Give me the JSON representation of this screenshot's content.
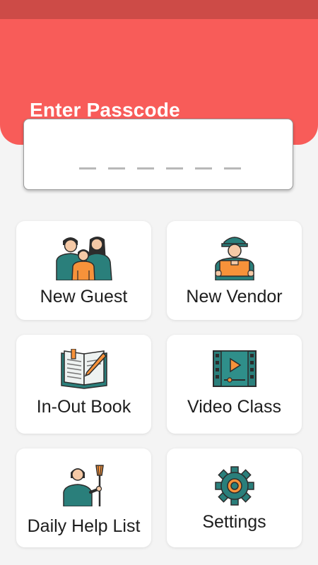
{
  "header": {
    "title": "Enter Passcode"
  },
  "passcode": {
    "length": 6,
    "entered": ""
  },
  "menu": [
    {
      "label": "New Guest",
      "icon": "family-icon"
    },
    {
      "label": "New Vendor",
      "icon": "delivery-person-icon"
    },
    {
      "label": "In-Out Book",
      "icon": "book-icon"
    },
    {
      "label": "Video Class",
      "icon": "video-icon"
    },
    {
      "label": "Daily Help List",
      "icon": "house-help-icon"
    },
    {
      "label": "Settings",
      "icon": "gear-icon"
    }
  ],
  "colors": {
    "header": "#f85c59",
    "status_bar": "#cd4b47",
    "icon_teal": "#2a7f7b",
    "icon_orange": "#f7923a",
    "icon_dark": "#2c2c2c"
  }
}
